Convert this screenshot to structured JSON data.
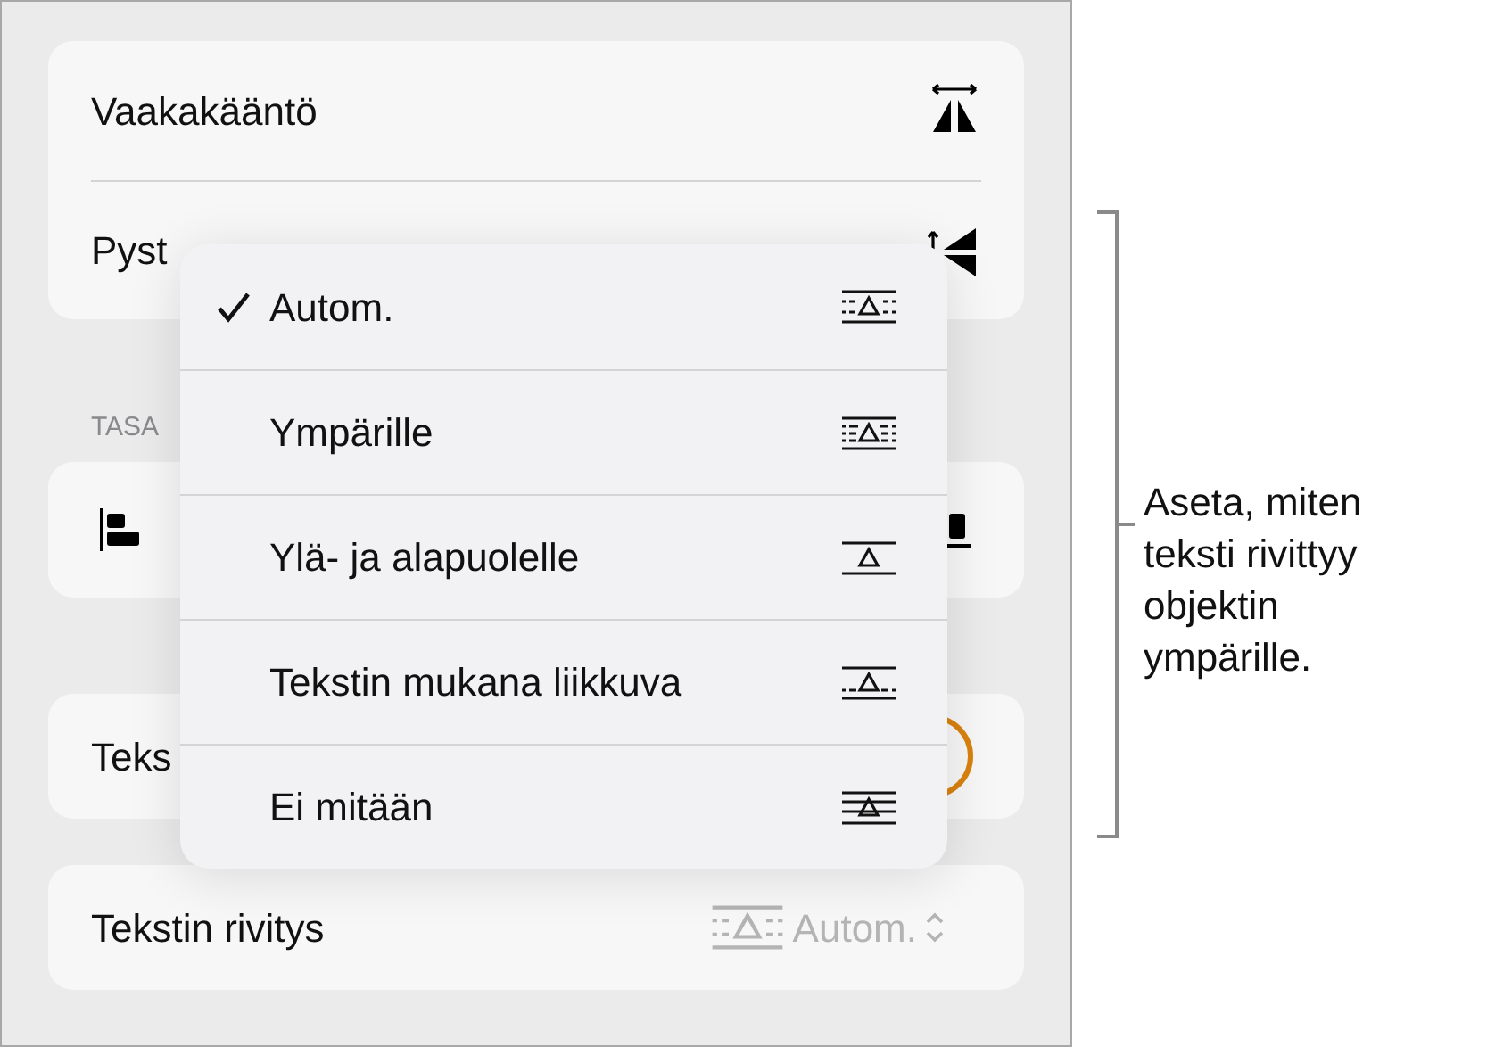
{
  "flip_rows": [
    {
      "label": "Vaakakääntö",
      "kind": "flip_h"
    },
    {
      "label": "Pyst",
      "kind": "flip_v"
    }
  ],
  "section_header": "TASA",
  "text_row": {
    "label": "Teks"
  },
  "wrap_row": {
    "label": "Tekstin rivitys",
    "value": "Autom.",
    "kind": "auto"
  },
  "wrap_menu": [
    {
      "label": "Autom.",
      "kind": "auto",
      "selected": true
    },
    {
      "label": "Ympärille",
      "kind": "around",
      "selected": false
    },
    {
      "label": "Ylä- ja alapuolelle",
      "kind": "above_below",
      "selected": false
    },
    {
      "label": "Tekstin mukana liikkuva",
      "kind": "inline",
      "selected": false
    },
    {
      "label": "Ei mitään",
      "kind": "none",
      "selected": false
    }
  ],
  "annotation": "Aseta, miten teksti rivittyy objektin ympärille."
}
